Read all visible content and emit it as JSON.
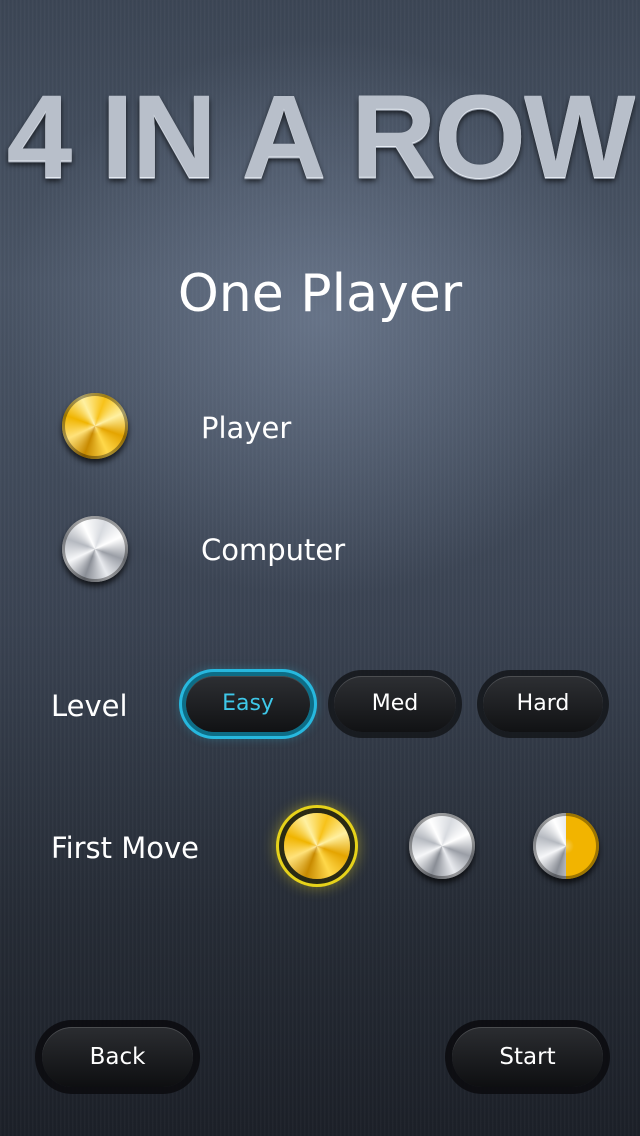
{
  "app": {
    "title": "4 IN A ROW"
  },
  "screen": {
    "heading": "One Player"
  },
  "players": [
    {
      "label": "Player",
      "piece": "gold"
    },
    {
      "label": "Computer",
      "piece": "silver"
    }
  ],
  "level": {
    "label": "Level",
    "options": [
      "Easy",
      "Med",
      "Hard"
    ],
    "selected": "Easy"
  },
  "first_move": {
    "label": "First Move",
    "options": [
      "gold-piece",
      "silver-piece",
      "random-piece"
    ],
    "selected": "gold-piece"
  },
  "footer": {
    "back_label": "Back",
    "start_label": "Start"
  },
  "colors": {
    "gold": "#f7c21a",
    "silver": "#d8dbe0",
    "level_active": "#27b8de",
    "first_move_highlight": "#e6d21a"
  }
}
